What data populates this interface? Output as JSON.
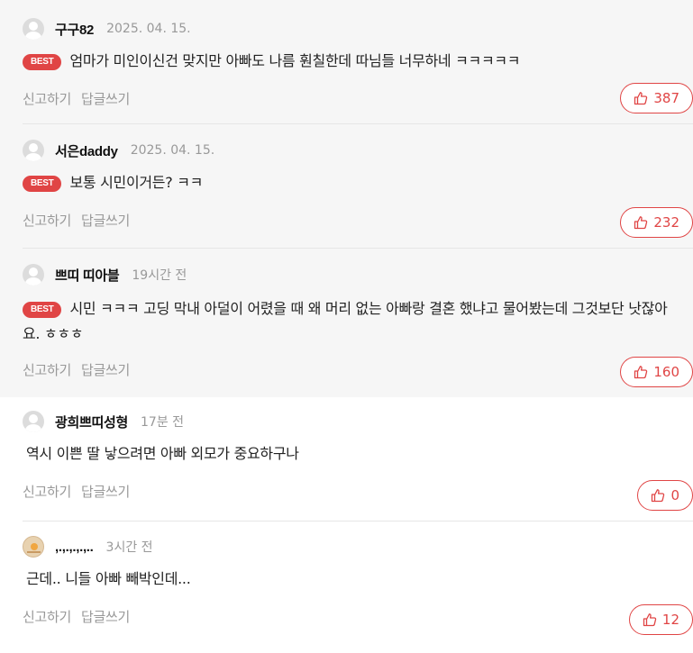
{
  "badge_label": "BEST",
  "actions": {
    "report": "신고하기",
    "reply": "답글쓰기"
  },
  "accent_color": "#e04545",
  "comments": [
    {
      "nickname": "구구82",
      "time": "2025. 04. 15.",
      "best": true,
      "text": "엄마가 미인이신건 맞지만 아빠도 나름 훤칠한데 따님들 너무하네 ㅋㅋㅋㅋㅋ",
      "likes": "387"
    },
    {
      "nickname": "서은daddy",
      "time": "2025. 04. 15.",
      "best": true,
      "text": "보통 시민이거든? ㅋㅋ",
      "likes": "232"
    },
    {
      "nickname": "쁘띠 띠아블",
      "time": "19시간 전",
      "best": true,
      "text": "시민 ㅋㅋㅋ 고딩 막내 아덜이 어렸을 때 왜 머리 없는 아빠랑 결혼 했냐고 물어봤는데 그것보단 낫잖아요. ㅎㅎㅎ",
      "likes": "160"
    },
    {
      "nickname": "광희쁘띠성형",
      "time": "17분 전",
      "best": false,
      "text": "역시 이쁜 딸 낳으려면 아빠 외모가 중요하구나",
      "likes": "0"
    },
    {
      "nickname": ",.,.,.,.,..",
      "time": "3시간 전",
      "best": false,
      "text": "근데.. 니들 아빠 빼박인데...",
      "likes": "12"
    }
  ]
}
